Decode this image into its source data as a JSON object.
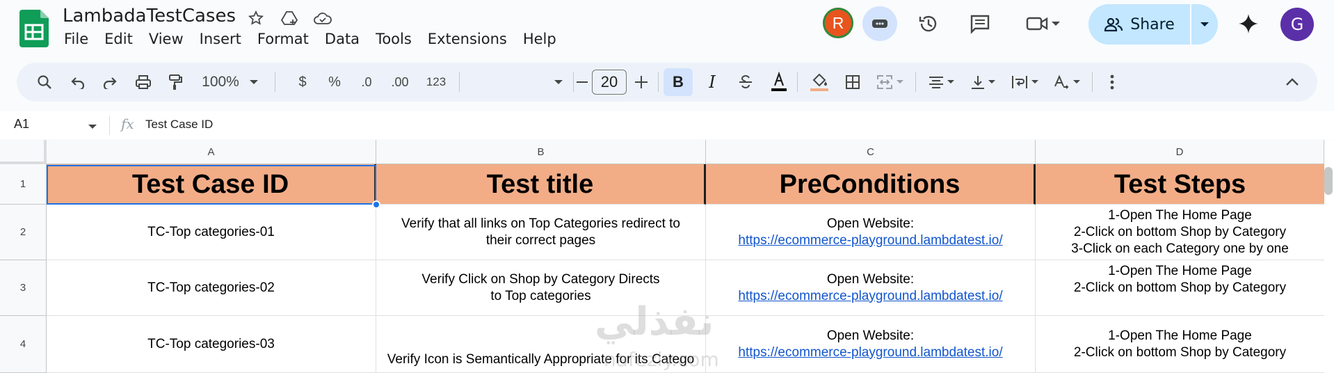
{
  "app": {
    "doc_title": "LambadaTestCases",
    "menu": [
      "File",
      "Edit",
      "View",
      "Insert",
      "Format",
      "Data",
      "Tools",
      "Extensions",
      "Help"
    ],
    "share_label": "Share",
    "user_avatar_letter": "R",
    "account_avatar_letter": "G"
  },
  "toolbar": {
    "zoom": "100%",
    "currency": "$",
    "percent": "%",
    "dec_decrease": ".0",
    "dec_increase": ".00",
    "number_format": "123",
    "font_size": "20",
    "bold_label": "B",
    "italic_label": "I"
  },
  "formula_bar": {
    "cell_ref": "A1",
    "fx": "fx",
    "value": "Test Case ID"
  },
  "sheet": {
    "columns": [
      "A",
      "B",
      "C",
      "D"
    ],
    "rows": [
      "1",
      "2",
      "3",
      "4"
    ],
    "header": [
      "Test Case ID",
      "Test title",
      "PreConditions",
      "Test Steps"
    ],
    "data": [
      {
        "id": "TC-Top categories-01",
        "title_l1": "Verify that all links on Top Categories redirect to",
        "title_l2": "their correct pages",
        "pre_l1": "Open Website:",
        "pre_link": "https://ecommerce-playground.lambdatest.io/",
        "steps_l1": "1-Open  The Home Page",
        "steps_l2": "2-Click on bottom Shop by Category",
        "steps_l3": "3-Click on each Category one by one"
      },
      {
        "id": "TC-Top categories-02",
        "title_l1": "Verify Click on Shop by Category Directs",
        "title_l2": "to Top categories",
        "pre_l1": "Open Website:",
        "pre_link": "https://ecommerce-playground.lambdatest.io/",
        "steps_l1": "1-Open  The Home Page",
        "steps_l2": "2-Click on bottom Shop by Category"
      },
      {
        "id": "TC-Top categories-03",
        "title_l1": "Verify Icon is Semantically Appropriate for its Catego",
        "pre_l1": "Open Website:",
        "pre_link": "https://ecommerce-playground.lambdatest.io/",
        "steps_l1": "1-Open  The Home Page",
        "steps_l2": "2-Click on bottom Shop by Category"
      }
    ]
  },
  "watermark": {
    "main": "نفذلي",
    "sub": "nafezly.com"
  },
  "colors": {
    "header_fill": "#f2ad87",
    "selection": "#1a73e8",
    "link": "#1155cc",
    "share_bg": "#c2e7ff"
  }
}
